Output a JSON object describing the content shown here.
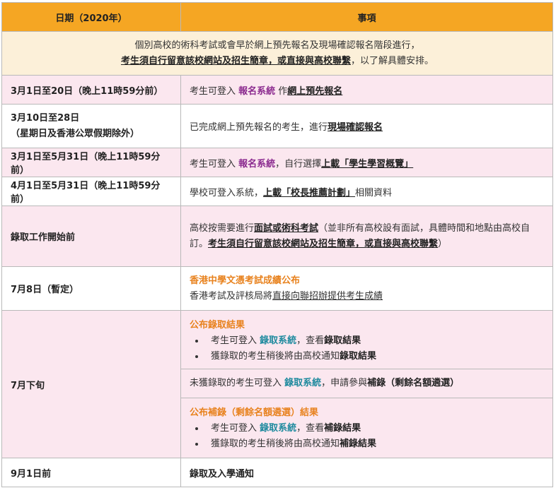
{
  "header": {
    "col1": "日期（2020年）",
    "col2": "事項"
  },
  "intro": {
    "line1": "個別高校的術科考試或會早於網上預先報名及現場確認報名階段進行，",
    "line2_bold": "考生須自行留意該校網站及招生簡章，或直接與高校聯繫",
    "line2_rest": "，以了解具體安排。"
  },
  "rows": [
    {
      "date": "3月1日至20日（晚上11時59分前）",
      "p1": "考生可登入 ",
      "link": "報名系統",
      "p2": " 作",
      "bold": "網上預先報名"
    },
    {
      "date_line1": "3月10日至28日",
      "date_line2": "（星期日及香港公眾假期除外）",
      "p1": "已完成網上預先報名的考生，進行",
      "bold": "現場確認報名"
    },
    {
      "date": "3月1日至5月31日（晚上11時59分前）",
      "p1": "考生可登入 ",
      "link": "報名系統",
      "p2": "，自行選擇",
      "bold": "上載「學生學習概覽」"
    },
    {
      "date": "4月1日至5月31日（晚上11時59分前）",
      "p1": "學校可登入系統，",
      "bold": "上載「校長推薦計劃」",
      "p2": "相關資料"
    },
    {
      "date": "錄取工作開始前",
      "p1": "高校按需要進行",
      "bold1": "面試或術科考試",
      "p2": "（並非所有高校設有面試，具體時間和地點由高校自訂。",
      "bold2": "考生須自行留意該校網站及招生簡章，或直接與高校聯繫",
      "p3": "）"
    },
    {
      "date": "7月8日（暫定）",
      "heading": "香港中學文憑考試成績公布",
      "p1": "香港考試及評核局將",
      "underline": "直接向聯招辦提供考生成績"
    },
    {
      "date": "7月下旬",
      "block1": {
        "heading": "公布錄取結果",
        "item1_p1": "考生可登入 ",
        "item1_link": "錄取系統",
        "item1_p2": "，查看",
        "item1_bold": "錄取結果",
        "item2_p1": "獲錄取的考生稍後將由高校通知",
        "item2_bold": "錄取結果"
      },
      "block2": {
        "p1": "未獲錄取的考生可登入 ",
        "link": "錄取系統",
        "p2": "，申請參與",
        "bold": "補錄（剩餘名額遴選）"
      },
      "block3": {
        "heading": "公布補錄（剩餘名額遴選）結果",
        "item1_p1": "考生可登入 ",
        "item1_link": "錄取系統",
        "item1_p2": "，查看",
        "item1_bold": "補錄結果",
        "item2_p1": "獲錄取的考生稍後將由高校通知",
        "item2_bold": "補錄結果"
      }
    },
    {
      "date": "9月1日前",
      "bold": "錄取及入學通知"
    }
  ],
  "colors": {
    "header": "#f5a623",
    "pink": "#fbe7ef",
    "cream": "#fcf0d9",
    "purple": "#8b2a8f",
    "teal": "#1e8a9e",
    "orange": "#e8821e"
  }
}
